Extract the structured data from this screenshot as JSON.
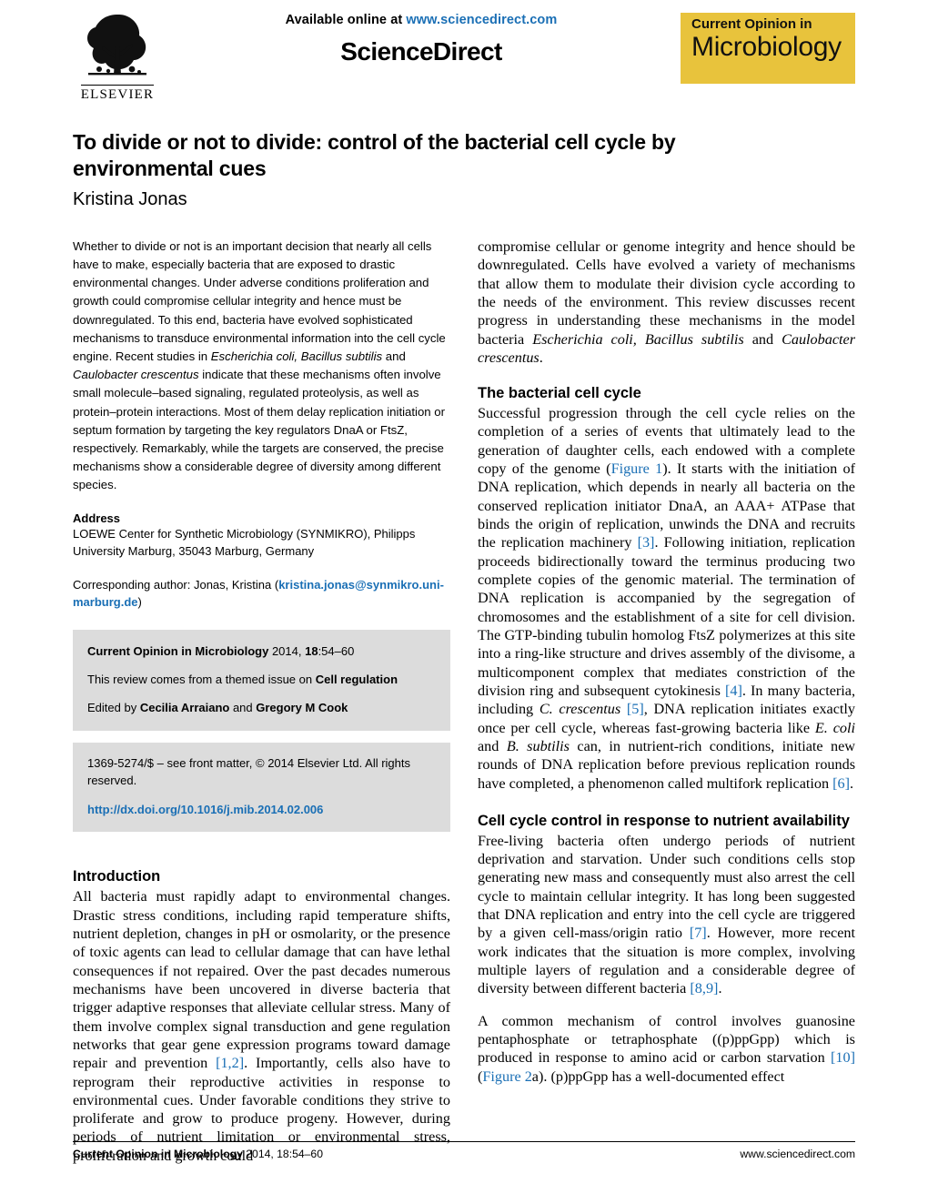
{
  "masthead": {
    "available_prefix": "Available online at ",
    "available_url": "www.sciencedirect.com",
    "wordmark": "ScienceDirect",
    "publisher": "ELSEVIER",
    "badge_line1": "Current Opinion in",
    "badge_line2": "Microbiology",
    "badge_color": "#e8c33c",
    "link_color": "#1a6fb5"
  },
  "article": {
    "title": "To divide or not to divide: control of the bacterial cell cycle by environmental cues",
    "author": "Kristina Jonas"
  },
  "abstract": {
    "part1": "Whether to divide or not is an important decision that nearly all cells have to make, especially bacteria that are exposed to drastic environmental changes. Under adverse conditions proliferation and growth could compromise cellular integrity and hence must be downregulated. To this end, bacteria have evolved sophisticated mechanisms to transduce environmental information into the cell cycle engine. Recent studies in ",
    "italic1": "Escherichia coli, Bacillus subtilis",
    "part2": " and ",
    "italic2": "Caulobacter crescentus",
    "part3": " indicate that these mechanisms often involve small molecule–based signaling, regulated proteolysis, as well as protein–protein interactions. Most of them delay replication initiation or septum formation by targeting the key regulators DnaA or FtsZ, respectively. Remarkably, while the targets are conserved, the precise mechanisms show a considerable degree of diversity among different species."
  },
  "address": {
    "heading": "Address",
    "text": "LOEWE Center for Synthetic Microbiology (SYNMIKRO), Philipps University Marburg, 35043 Marburg, Germany",
    "corresponding_prefix": "Corresponding author: Jonas, Kristina (",
    "corresponding_email": "kristina.jonas@synmikro.uni-marburg.de",
    "corresponding_suffix": ")"
  },
  "issue_box": {
    "journal_name": "Current Opinion in Microbiology",
    "citation_rest": " 2014, ",
    "volume": "18",
    "pages": ":54–60",
    "themed_prefix": "This review comes from a themed issue on ",
    "themed_topic": "Cell regulation",
    "edited_prefix": "Edited by ",
    "editor1": "Cecilia Arraiano",
    "edited_mid": " and ",
    "editor2": "Gregory M Cook"
  },
  "copyright_box": {
    "text": "1369-5274/$ – see front matter, © 2014 Elsevier Ltd. All rights reserved.",
    "doi": "http://dx.doi.org/10.1016/j.mib.2014.02.006"
  },
  "sections": {
    "introduction": {
      "heading": "Introduction",
      "p1_a": "All bacteria must rapidly adapt to environmental changes. Drastic stress conditions, including rapid temperature shifts, nutrient depletion, changes in pH or osmolarity, or the presence of toxic agents can lead to cellular damage that can have lethal consequences if not repaired. Over the past decades numerous mechanisms have been uncovered in diverse bacteria that trigger adaptive responses that alleviate cellular stress. Many of them involve complex signal transduction and gene regulation networks that gear gene expression programs toward damage repair and prevention ",
      "p1_ref": "[1,2]",
      "p1_b": ". Importantly, cells also have to reprogram their reproductive activities in response to environmental cues. Under favorable conditions they strive to proliferate and grow to produce progeny. However, during periods of nutrient limitation or environmental stress, proliferation and growth could"
    },
    "continuation": {
      "a": "compromise cellular or genome integrity and hence should be downregulated. Cells have evolved a variety of mechanisms that allow them to modulate their division cycle according to the needs of the environment. This review discusses recent progress in understanding these mechanisms in the model bacteria ",
      "i1": "Escherichia coli, Bacillus subtilis",
      "b": " and ",
      "i2": "Caulobacter crescentus",
      "c": "."
    },
    "cell_cycle": {
      "heading": "The bacterial cell cycle",
      "a": "Successful progression through the cell cycle relies on the completion of a series of events that ultimately lead to the generation of daughter cells, each endowed with a complete copy of the genome (",
      "fig1": "Figure 1",
      "b": "). It starts with the initiation of DNA replication, which depends in nearly all bacteria on the conserved replication initiator DnaA, an AAA+ ATPase that binds the origin of replication, unwinds the DNA and recruits the replication machinery ",
      "ref3": "[3]",
      "c": ". Following initiation, replication proceeds bidirectionally toward the terminus producing two complete copies of the genomic material. The termination of DNA replication is accompanied by the segregation of chromosomes and the establishment of a site for cell division. The GTP-binding tubulin homolog FtsZ polymerizes at this site into a ring-like structure and drives assembly of the divisome, a multicomponent complex that mediates constriction of the division ring and subsequent cytokinesis ",
      "ref4": "[4]",
      "d": ". In many bacteria, including ",
      "i1": "C. crescentus",
      "e": " ",
      "ref5": "[5]",
      "f": ", DNA replication initiates exactly once per cell cycle, whereas fast-growing bacteria like ",
      "i2": "E. coli",
      "g": " and ",
      "i3": "B. subtilis",
      "h": " can, in nutrient-rich conditions, initiate new rounds of DNA replication before previous replication rounds have completed, a phenomenon called multifork replication ",
      "ref6": "[6]",
      "i": "."
    },
    "nutrient": {
      "heading": "Cell cycle control in response to nutrient availability",
      "p1_a": "Free-living bacteria often undergo periods of nutrient deprivation and starvation. Under such conditions cells stop generating new mass and consequently must also arrest the cell cycle to maintain cellular integrity. It has long been suggested that DNA replication and entry into the cell cycle are triggered by a given cell-mass/origin ratio ",
      "p1_ref7": "[7]",
      "p1_b": ". However, more recent work indicates that the situation is more complex, involving multiple layers of regulation and a considerable degree of diversity between different bacteria ",
      "p1_ref89": "[8,9]",
      "p1_c": ".",
      "p2_a": "A common mechanism of control involves guanosine pentaphosphate or tetraphosphate ((p)ppGpp) which is produced in response to amino acid or carbon starvation ",
      "p2_ref10": "[10]",
      "p2_b": " (",
      "p2_fig2": "Figure 2",
      "p2_c": "a). (p)ppGpp has a well-documented effect"
    }
  },
  "footer": {
    "journal": "Current Opinion in Microbiology",
    "citation": " 2014, 18:54–60",
    "url": "www.sciencedirect.com"
  }
}
